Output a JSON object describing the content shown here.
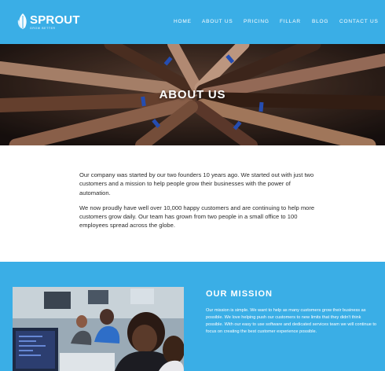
{
  "brand": {
    "name": "SPROUT",
    "tagline": "GROW BETTER",
    "colors": {
      "primary": "#3aaee6",
      "text": "#2b2b2b"
    },
    "logo_icon": "leaf-icon"
  },
  "nav": {
    "items": [
      {
        "label": "HOME"
      },
      {
        "label": "ABOUT US"
      },
      {
        "label": "PRICING"
      },
      {
        "label": "FILLAR"
      },
      {
        "label": "BLOG"
      },
      {
        "label": "CONTACT US"
      }
    ]
  },
  "hero": {
    "title": "ABOUT US"
  },
  "about": {
    "paragraphs": [
      "Our company was started by our two founders 10 years ago. We started out with just two customers and a mission to help people grow their businesses with the power of automation.",
      "We now proudly have well over 10,000 happy customers and are continuing to help more customers grow daily. Our team has grown from two people in a small office to 100 employees spread across the globe."
    ]
  },
  "mission": {
    "title": "OUR MISSION",
    "text": "Our mission is simple. We want to help as many customers grow their business as possible. We love helping push our customers to new limits that they didn't think possible. With our easy to use software and dedicated services team we will continue to focus on creating the best customer experience possible."
  }
}
